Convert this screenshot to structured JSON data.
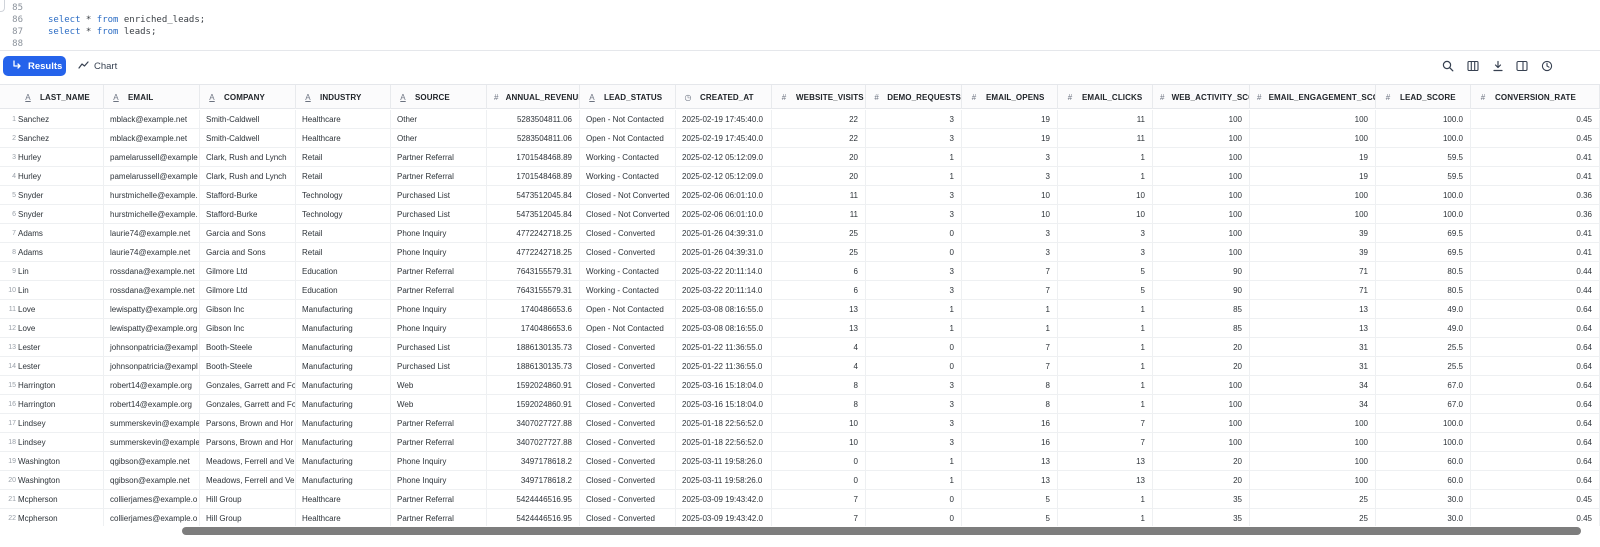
{
  "editor": {
    "lines": [
      {
        "num": "85",
        "parts": []
      },
      {
        "num": "86",
        "parts": [
          {
            "t": "select",
            "k": true
          },
          {
            "t": " * ",
            "k": false
          },
          {
            "t": "from",
            "k": true
          },
          {
            "t": " enriched_leads;",
            "k": false
          }
        ]
      },
      {
        "num": "87",
        "parts": [
          {
            "t": "select",
            "k": true
          },
          {
            "t": " * ",
            "k": false
          },
          {
            "t": "from",
            "k": true
          },
          {
            "t": " leads;",
            "k": false
          }
        ]
      },
      {
        "num": "88",
        "parts": []
      }
    ]
  },
  "toolbar": {
    "results_label": "Results",
    "chart_label": "Chart",
    "icons": [
      "search-icon",
      "columns-icon",
      "download-icon",
      "panel-icon",
      "history-icon"
    ]
  },
  "table": {
    "columns": [
      {
        "name": "LAST_NAME",
        "type": "text"
      },
      {
        "name": "EMAIL",
        "type": "text"
      },
      {
        "name": "COMPANY",
        "type": "text"
      },
      {
        "name": "INDUSTRY",
        "type": "text"
      },
      {
        "name": "SOURCE",
        "type": "text"
      },
      {
        "name": "ANNUAL_REVENUE",
        "type": "number"
      },
      {
        "name": "LEAD_STATUS",
        "type": "text"
      },
      {
        "name": "CREATED_AT",
        "type": "time"
      },
      {
        "name": "WEBSITE_VISITS",
        "type": "number"
      },
      {
        "name": "DEMO_REQUESTS",
        "type": "number"
      },
      {
        "name": "EMAIL_OPENS",
        "type": "number"
      },
      {
        "name": "EMAIL_CLICKS",
        "type": "number"
      },
      {
        "name": "WEB_ACTIVITY_SCO",
        "type": "number"
      },
      {
        "name": "EMAIL_ENGAGEMENT_SCO",
        "type": "number"
      },
      {
        "name": "LEAD_SCORE",
        "type": "number"
      },
      {
        "name": "CONVERSION_RATE",
        "type": "number"
      }
    ],
    "rows": [
      [
        "1",
        "Sanchez",
        "mblack@example.net",
        "Smith-Caldwell",
        "Healthcare",
        "Other",
        "5283504811.06",
        "Open - Not Contacted",
        "2025-02-19 17:45:40.0",
        "22",
        "3",
        "19",
        "11",
        "100",
        "100",
        "100.0",
        "0.45"
      ],
      [
        "2",
        "Sanchez",
        "mblack@example.net",
        "Smith-Caldwell",
        "Healthcare",
        "Other",
        "5283504811.06",
        "Open - Not Contacted",
        "2025-02-19 17:45:40.0",
        "22",
        "3",
        "19",
        "11",
        "100",
        "100",
        "100.0",
        "0.45"
      ],
      [
        "3",
        "Hurley",
        "pamelarussell@example",
        "Clark, Rush and Lynch",
        "Retail",
        "Partner Referral",
        "1701548468.89",
        "Working - Contacted",
        "2025-02-12 05:12:09.0",
        "20",
        "1",
        "3",
        "1",
        "100",
        "19",
        "59.5",
        "0.41"
      ],
      [
        "4",
        "Hurley",
        "pamelarussell@example",
        "Clark, Rush and Lynch",
        "Retail",
        "Partner Referral",
        "1701548468.89",
        "Working - Contacted",
        "2025-02-12 05:12:09.0",
        "20",
        "1",
        "3",
        "1",
        "100",
        "19",
        "59.5",
        "0.41"
      ],
      [
        "5",
        "Snyder",
        "hurstmichelle@example.",
        "Stafford-Burke",
        "Technology",
        "Purchased List",
        "5473512045.84",
        "Closed - Not Converted",
        "2025-02-06 06:01:10.0",
        "11",
        "3",
        "10",
        "10",
        "100",
        "100",
        "100.0",
        "0.36"
      ],
      [
        "6",
        "Snyder",
        "hurstmichelle@example.",
        "Stafford-Burke",
        "Technology",
        "Purchased List",
        "5473512045.84",
        "Closed - Not Converted",
        "2025-02-06 06:01:10.0",
        "11",
        "3",
        "10",
        "10",
        "100",
        "100",
        "100.0",
        "0.36"
      ],
      [
        "7",
        "Adams",
        "laurie74@example.net",
        "Garcia and Sons",
        "Retail",
        "Phone Inquiry",
        "4772242718.25",
        "Closed - Converted",
        "2025-01-26 04:39:31.0",
        "25",
        "0",
        "3",
        "3",
        "100",
        "39",
        "69.5",
        "0.41"
      ],
      [
        "8",
        "Adams",
        "laurie74@example.net",
        "Garcia and Sons",
        "Retail",
        "Phone Inquiry",
        "4772242718.25",
        "Closed - Converted",
        "2025-01-26 04:39:31.0",
        "25",
        "0",
        "3",
        "3",
        "100",
        "39",
        "69.5",
        "0.41"
      ],
      [
        "9",
        "Lin",
        "rossdana@example.net",
        "Gilmore Ltd",
        "Education",
        "Partner Referral",
        "7643155579.31",
        "Working - Contacted",
        "2025-03-22 20:11:14.0",
        "6",
        "3",
        "7",
        "5",
        "90",
        "71",
        "80.5",
        "0.44"
      ],
      [
        "10",
        "Lin",
        "rossdana@example.net",
        "Gilmore Ltd",
        "Education",
        "Partner Referral",
        "7643155579.31",
        "Working - Contacted",
        "2025-03-22 20:11:14.0",
        "6",
        "3",
        "7",
        "5",
        "90",
        "71",
        "80.5",
        "0.44"
      ],
      [
        "11",
        "Love",
        "lewispatty@example.org",
        "Gibson Inc",
        "Manufacturing",
        "Phone Inquiry",
        "1740486653.6",
        "Open - Not Contacted",
        "2025-03-08 08:16:55.0",
        "13",
        "1",
        "1",
        "1",
        "85",
        "13",
        "49.0",
        "0.64"
      ],
      [
        "12",
        "Love",
        "lewispatty@example.org",
        "Gibson Inc",
        "Manufacturing",
        "Phone Inquiry",
        "1740486653.6",
        "Open - Not Contacted",
        "2025-03-08 08:16:55.0",
        "13",
        "1",
        "1",
        "1",
        "85",
        "13",
        "49.0",
        "0.64"
      ],
      [
        "13",
        "Lester",
        "johnsonpatricia@exampl",
        "Booth-Steele",
        "Manufacturing",
        "Purchased List",
        "1886130135.73",
        "Closed - Converted",
        "2025-01-22 11:36:55.0",
        "4",
        "0",
        "7",
        "1",
        "20",
        "31",
        "25.5",
        "0.64"
      ],
      [
        "14",
        "Lester",
        "johnsonpatricia@exampl",
        "Booth-Steele",
        "Manufacturing",
        "Purchased List",
        "1886130135.73",
        "Closed - Converted",
        "2025-01-22 11:36:55.0",
        "4",
        "0",
        "7",
        "1",
        "20",
        "31",
        "25.5",
        "0.64"
      ],
      [
        "15",
        "Harrington",
        "robert14@example.org",
        "Gonzales, Garrett and Fo",
        "Manufacturing",
        "Web",
        "1592024860.91",
        "Closed - Converted",
        "2025-03-16 15:18:04.0",
        "8",
        "3",
        "8",
        "1",
        "100",
        "34",
        "67.0",
        "0.64"
      ],
      [
        "16",
        "Harrington",
        "robert14@example.org",
        "Gonzales, Garrett and Fo",
        "Manufacturing",
        "Web",
        "1592024860.91",
        "Closed - Converted",
        "2025-03-16 15:18:04.0",
        "8",
        "3",
        "8",
        "1",
        "100",
        "34",
        "67.0",
        "0.64"
      ],
      [
        "17",
        "Lindsey",
        "summerskevin@example",
        "Parsons, Brown and Hor",
        "Manufacturing",
        "Partner Referral",
        "3407027727.88",
        "Closed - Converted",
        "2025-01-18 22:56:52.0",
        "10",
        "3",
        "16",
        "7",
        "100",
        "100",
        "100.0",
        "0.64"
      ],
      [
        "18",
        "Lindsey",
        "summerskevin@example",
        "Parsons, Brown and Hor",
        "Manufacturing",
        "Partner Referral",
        "3407027727.88",
        "Closed - Converted",
        "2025-01-18 22:56:52.0",
        "10",
        "3",
        "16",
        "7",
        "100",
        "100",
        "100.0",
        "0.64"
      ],
      [
        "19",
        "Washington",
        "qgibson@example.net",
        "Meadows, Ferrell and Ve",
        "Manufacturing",
        "Phone Inquiry",
        "3497178618.2",
        "Closed - Converted",
        "2025-03-11 19:58:26.0",
        "0",
        "1",
        "13",
        "13",
        "20",
        "100",
        "60.0",
        "0.64"
      ],
      [
        "20",
        "Washington",
        "qgibson@example.net",
        "Meadows, Ferrell and Ve",
        "Manufacturing",
        "Phone Inquiry",
        "3497178618.2",
        "Closed - Converted",
        "2025-03-11 19:58:26.0",
        "0",
        "1",
        "13",
        "13",
        "20",
        "100",
        "60.0",
        "0.64"
      ],
      [
        "21",
        "Mcpherson",
        "collierjames@example.o",
        "Hill Group",
        "Healthcare",
        "Partner Referral",
        "5424446516.95",
        "Closed - Converted",
        "2025-03-09 19:43:42.0",
        "7",
        "0",
        "5",
        "1",
        "35",
        "25",
        "30.0",
        "0.45"
      ],
      [
        "22",
        "Mcpherson",
        "collierjames@example.o",
        "Hill Group",
        "Healthcare",
        "Partner Referral",
        "5424446516.95",
        "Closed - Converted",
        "2025-03-09 19:43:42.0",
        "7",
        "0",
        "5",
        "1",
        "35",
        "25",
        "30.0",
        "0.45"
      ]
    ]
  }
}
